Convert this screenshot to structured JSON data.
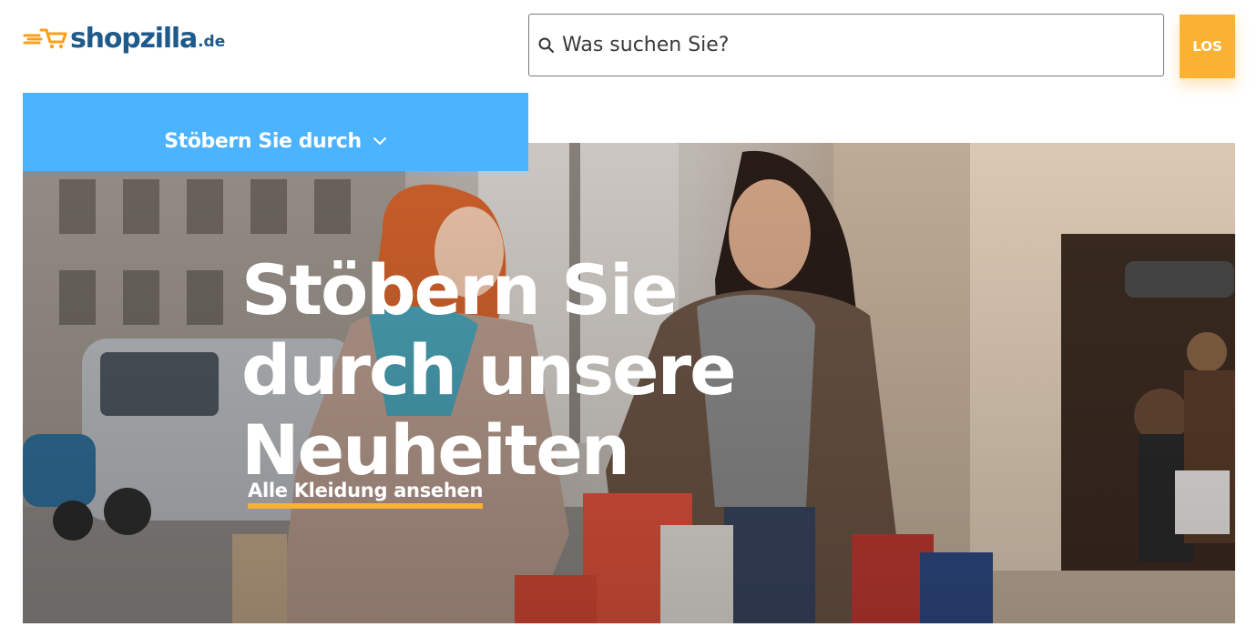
{
  "header": {
    "logo_text": "shopzilla",
    "logo_tld": ".de",
    "search": {
      "placeholder": "Was suchen Sie?"
    },
    "go_label": "LOS"
  },
  "nav": {
    "browse_label": "Stöbern Sie durch"
  },
  "hero": {
    "title_lines": [
      "Stöbern Sie",
      "durch unsere",
      "Neuheiten"
    ],
    "cta_label": "Alle Kleidung ansehen"
  },
  "colors": {
    "brand_blue": "#1e5a8a",
    "nav_blue": "#4bb3ff",
    "accent_orange": "#f9b233"
  },
  "icons": [
    "cart-logo-icon",
    "search-icon",
    "chevron-down-icon"
  ]
}
